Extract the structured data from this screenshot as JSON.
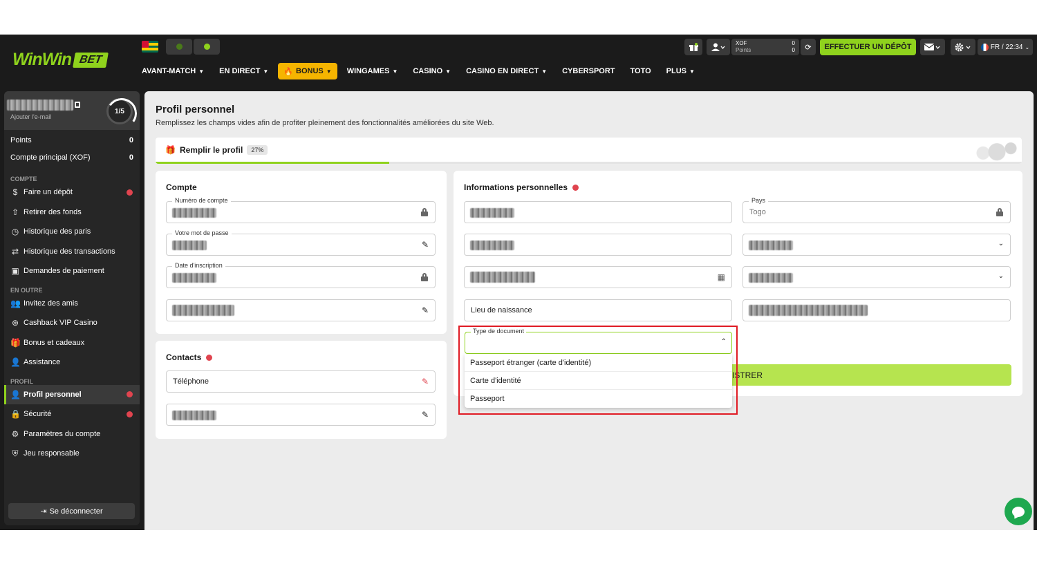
{
  "header": {
    "logo_text": "WinWin",
    "logo_badge": "BET",
    "currency": "XOF",
    "points_label": "Points",
    "balance": "0",
    "points": "0",
    "deposit_label": "EFFECTUER UN DÉPÔT",
    "lang_time": "FR / 22:34",
    "nav": [
      {
        "label": "AVANT-MATCH",
        "chevron": true
      },
      {
        "label": "EN DIRECT",
        "chevron": true
      },
      {
        "label": "BONUS",
        "chevron": true,
        "highlight": true
      },
      {
        "label": "WINGAMES",
        "chevron": true
      },
      {
        "label": "CASINO",
        "chevron": true
      },
      {
        "label": "CASINO EN DIRECT",
        "chevron": true
      },
      {
        "label": "CYBERSPORT",
        "chevron": false
      },
      {
        "label": "TOTO",
        "chevron": false
      },
      {
        "label": "PLUS",
        "chevron": true
      }
    ]
  },
  "sidebar": {
    "add_email": "Ajouter l'e-mail",
    "level": "1/5",
    "points_label": "Points",
    "points_value": "0",
    "account_label": "Compte principal (XOF)",
    "account_value": "0",
    "section_compte": "COMPTE",
    "section_outre": "EN OUTRE",
    "section_profil": "PROFIL",
    "items_compte": [
      {
        "label": "Faire un dépôt",
        "icon": "dollar-icon",
        "badge": true
      },
      {
        "label": "Retirer des fonds",
        "icon": "withdraw-icon",
        "badge": false
      },
      {
        "label": "Historique des paris",
        "icon": "clock-icon",
        "badge": false
      },
      {
        "label": "Historique des transactions",
        "icon": "transfer-icon",
        "badge": false
      },
      {
        "label": "Demandes de paiement",
        "icon": "payment-icon",
        "badge": false
      }
    ],
    "items_outre": [
      {
        "label": "Invitez des amis",
        "icon": "friends-icon"
      },
      {
        "label": "Cashback VIP Casino",
        "icon": "cashback-icon"
      },
      {
        "label": "Bonus et cadeaux",
        "icon": "gift-icon"
      },
      {
        "label": "Assistance",
        "icon": "support-icon"
      }
    ],
    "items_profil": [
      {
        "label": "Profil personnel",
        "icon": "user-icon",
        "badge": true,
        "active": true
      },
      {
        "label": "Sécurité",
        "icon": "lock-icon",
        "badge": true,
        "active": false
      },
      {
        "label": "Paramètres du compte",
        "icon": "gear-icon",
        "badge": false,
        "active": false
      },
      {
        "label": "Jeu responsable",
        "icon": "shield-icon",
        "badge": false,
        "active": false
      }
    ],
    "logout": "Se déconnecter"
  },
  "main": {
    "title": "Profil personnel",
    "subtitle": "Remplissez les champs vides afin de profiter pleinement des fonctionnalités améliorées du site Web.",
    "fill_label": "Remplir le profil",
    "fill_percent": "27%",
    "fill_fraction": 0.27,
    "compte": {
      "title": "Compte",
      "account_number_label": "Numéro de compte",
      "password_label": "Votre mot de passe",
      "signup_date_label": "Date d'inscription"
    },
    "contacts": {
      "title": "Contacts",
      "phone_placeholder": "Téléphone"
    },
    "personal": {
      "title": "Informations personnelles",
      "country_label": "Pays",
      "country_value": "Togo",
      "birthplace_placeholder": "Lieu de naissance",
      "doc_type_label": "Type de document",
      "doc_options": [
        "Passeport étranger (carte d'identité)",
        "Carte d'identité",
        "Passeport"
      ],
      "save_partial": "ISTRER"
    }
  },
  "colors": {
    "accent_green": "#8fd21d",
    "bonus_yellow": "#f5b400",
    "badge_red": "#e0444f",
    "highlight_red": "#e01b24",
    "dark_bg": "#1b1b1b"
  }
}
